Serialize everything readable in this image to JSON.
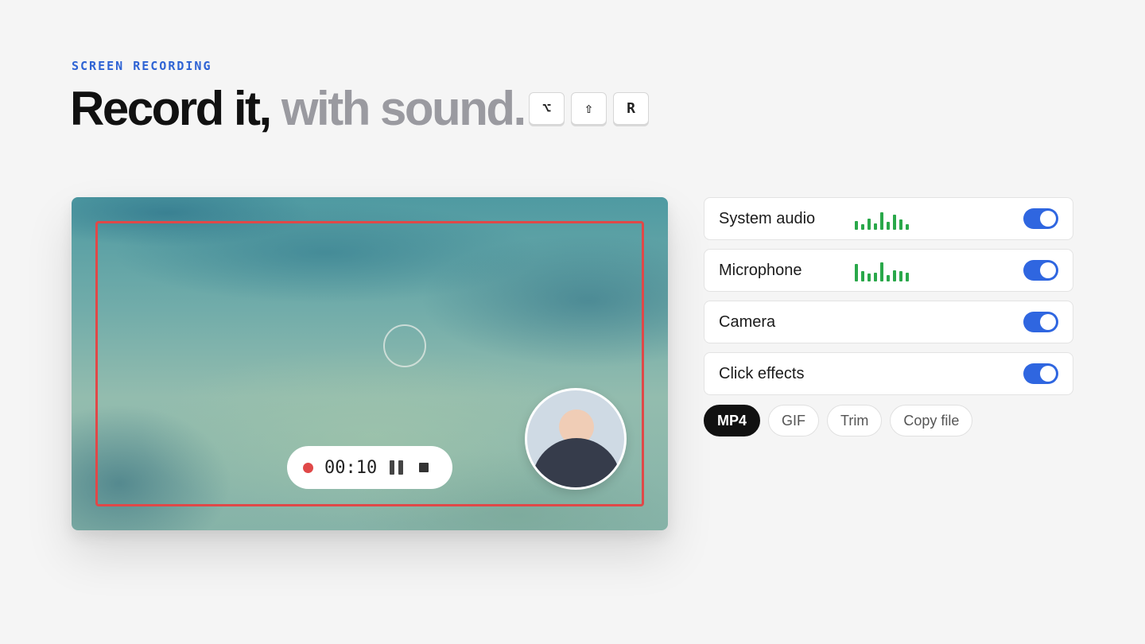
{
  "header": {
    "eyebrow": "SCREEN RECORDING",
    "title_dark": "Record it,",
    "title_light": "with sound.",
    "shortcut_keys": [
      "⌥",
      "⇧",
      "R"
    ]
  },
  "recorder": {
    "timer": "00:10",
    "state": "recording",
    "icons": [
      "record-dot-icon",
      "pause-icon",
      "stop-icon"
    ]
  },
  "settings": [
    {
      "label": "System audio",
      "enabled": true,
      "meter": [
        0.45,
        0.3,
        0.6,
        0.35,
        0.9,
        0.4,
        0.8,
        0.55,
        0.3
      ]
    },
    {
      "label": "Microphone",
      "enabled": true,
      "meter": [
        0.9,
        0.55,
        0.4,
        0.45,
        1.0,
        0.35,
        0.6,
        0.55,
        0.45
      ]
    },
    {
      "label": "Camera",
      "enabled": true
    },
    {
      "label": "Click effects",
      "enabled": true
    }
  ],
  "formats": [
    {
      "label": "MP4",
      "active": true
    },
    {
      "label": "GIF",
      "active": false
    },
    {
      "label": "Trim",
      "active": false
    },
    {
      "label": "Copy file",
      "active": false
    }
  ],
  "colors": {
    "accent": "#2f66e0",
    "record": "#e04848",
    "meter": "#2aa84a"
  }
}
